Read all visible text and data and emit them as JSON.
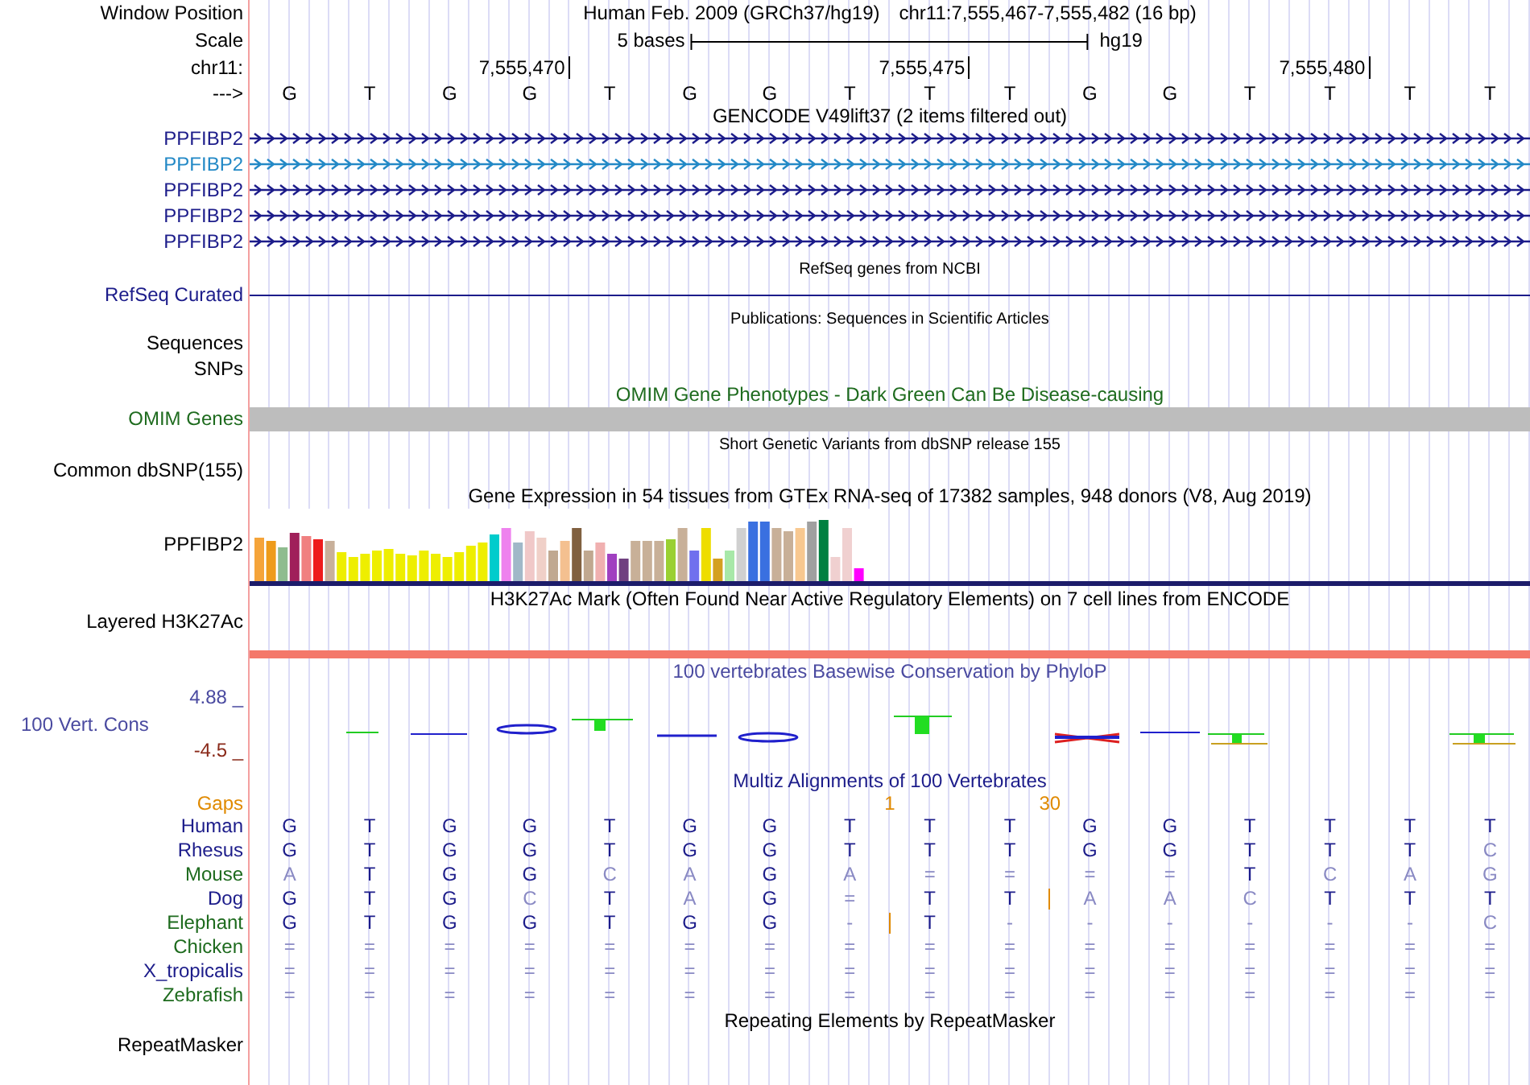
{
  "position_row": {
    "label": "Window Position",
    "assembly": "Human Feb. 2009 (GRCh37/hg19)",
    "range": "chr11:7,555,467-7,555,482 (16 bp)"
  },
  "scale_row": {
    "label": "Scale",
    "span": "5 bases",
    "assembly": "hg19"
  },
  "coordinate_row": {
    "label": "chr11:",
    "ticks": [
      "7,555,470",
      "7,555,475",
      "7,555,480"
    ]
  },
  "sequence_row": {
    "label": "--->",
    "bases": [
      "G",
      "T",
      "G",
      "G",
      "T",
      "G",
      "G",
      "T",
      "T",
      "T",
      "G",
      "G",
      "T",
      "T",
      "T",
      "T"
    ]
  },
  "tracks": [
    {
      "kind": "genes",
      "title": "GENCODE V49lift37 (2 items filtered out)",
      "items": [
        {
          "label": "PPFIBP2",
          "color": "#1c1c8a"
        },
        {
          "label": "PPFIBP2",
          "color": "#2389c6"
        },
        {
          "label": "PPFIBP2",
          "color": "#1c1c8a"
        },
        {
          "label": "PPFIBP2",
          "color": "#1c1c8a"
        },
        {
          "label": "PPFIBP2",
          "color": "#1c1c8a"
        }
      ]
    },
    {
      "kind": "curated",
      "title": "RefSeq genes from NCBI",
      "label": "RefSeq Curated"
    },
    {
      "kind": "publications",
      "title": "Publications: Sequences in Scientific Articles",
      "labels": [
        "Sequences",
        "SNPs"
      ]
    },
    {
      "kind": "omim",
      "title": "OMIM Gene Phenotypes - Dark Green Can Be Disease-causing",
      "label": "OMIM Genes"
    },
    {
      "kind": "snp",
      "title": "Short Genetic Variants from dbSNP release 155",
      "label": "Common dbSNP(155)"
    },
    {
      "kind": "expression",
      "title": "Gene Expression in 54 tissues from GTEx RNA-seq of 17382 samples, 948 donors (V8, Aug 2019)",
      "label": "PPFIBP2"
    },
    {
      "kind": "layered",
      "title": "H3K27Ac Mark (Often Found Near Active Regulatory Elements) on 7 cell lines from ENCODE",
      "label": "Layered H3K27Ac"
    },
    {
      "kind": "conservation",
      "title": "100 vertebrates Basewise Conservation by PhyloP",
      "label": "100 Vert. Cons",
      "max": "4.88 _",
      "min": "-4.5 _"
    },
    {
      "kind": "alignment",
      "title": "Multiz Alignments of 100 Vertebrates",
      "gaps_label": "Gaps",
      "gaps": [
        "1",
        "30"
      ],
      "species": [
        {
          "name": "Human",
          "color": "#1c1c8a",
          "bases": [
            {
              "base": "G",
              "match": true
            },
            {
              "base": "T",
              "match": true
            },
            {
              "base": "G",
              "match": true
            },
            {
              "base": "G",
              "match": true
            },
            {
              "base": "T",
              "match": true
            },
            {
              "base": "G",
              "match": true
            },
            {
              "base": "G",
              "match": true
            },
            {
              "base": "T",
              "match": true
            },
            {
              "base": "T",
              "match": true
            },
            {
              "base": "T",
              "match": true
            },
            {
              "base": "G",
              "match": true
            },
            {
              "base": "G",
              "match": true
            },
            {
              "base": "T",
              "match": true
            },
            {
              "base": "T",
              "match": true
            },
            {
              "base": "T",
              "match": true
            },
            {
              "base": "T",
              "match": true
            }
          ]
        },
        {
          "name": "Rhesus",
          "color": "#1c1c8a",
          "bases": [
            {
              "base": "G",
              "match": true
            },
            {
              "base": "T",
              "match": true
            },
            {
              "base": "G",
              "match": true
            },
            {
              "base": "G",
              "match": true
            },
            {
              "base": "T",
              "match": true
            },
            {
              "base": "G",
              "match": true
            },
            {
              "base": "G",
              "match": true
            },
            {
              "base": "T",
              "match": true
            },
            {
              "base": "T",
              "match": true
            },
            {
              "base": "T",
              "match": true
            },
            {
              "base": "G",
              "match": true
            },
            {
              "base": "G",
              "match": true
            },
            {
              "base": "T",
              "match": true
            },
            {
              "base": "T",
              "match": true
            },
            {
              "base": "T",
              "match": true
            },
            {
              "base": "C",
              "match": false
            }
          ]
        },
        {
          "name": "Mouse",
          "color": "#1e6b1e",
          "bases": [
            {
              "base": "A",
              "match": false
            },
            {
              "base": "T",
              "match": true
            },
            {
              "base": "G",
              "match": true
            },
            {
              "base": "G",
              "match": true
            },
            {
              "base": "C",
              "match": false
            },
            {
              "base": "A",
              "match": false
            },
            {
              "base": "G",
              "match": true
            },
            {
              "base": "A",
              "match": false
            },
            {
              "base": "=",
              "match": false
            },
            {
              "base": "=",
              "match": false
            },
            {
              "base": "=",
              "match": false
            },
            {
              "base": "=",
              "match": false
            },
            {
              "base": "T",
              "match": true
            },
            {
              "base": "C",
              "match": false
            },
            {
              "base": "A",
              "match": false
            },
            {
              "base": "G",
              "match": false
            }
          ]
        },
        {
          "name": "Dog",
          "color": "#1c1c8a",
          "bases": [
            {
              "base": "G",
              "match": true,
              "insert_after": false
            },
            {
              "base": "T",
              "match": true,
              "insert_after": false
            },
            {
              "base": "G",
              "match": true,
              "insert_after": false
            },
            {
              "base": "C",
              "match": false,
              "insert_after": false
            },
            {
              "base": "T",
              "match": true,
              "insert_after": false
            },
            {
              "base": "A",
              "match": false,
              "insert_after": false
            },
            {
              "base": "G",
              "match": true,
              "insert_after": false
            },
            {
              "base": "=",
              "match": false,
              "insert_after": false
            },
            {
              "base": "T",
              "match": true,
              "insert_after": false
            },
            {
              "base": "T",
              "match": true,
              "insert_after": true
            },
            {
              "base": "A",
              "match": false,
              "insert_after": false
            },
            {
              "base": "A",
              "match": false,
              "insert_after": false
            },
            {
              "base": "C",
              "match": false,
              "insert_after": false
            },
            {
              "base": "T",
              "match": true,
              "insert_after": false
            },
            {
              "base": "T",
              "match": true,
              "insert_after": false
            },
            {
              "base": "T",
              "match": true,
              "insert_after": false
            }
          ]
        },
        {
          "name": "Elephant",
          "color": "#1e6b1e",
          "bases": [
            {
              "base": "G",
              "match": true,
              "insert_after": false
            },
            {
              "base": "T",
              "match": true,
              "insert_after": false
            },
            {
              "base": "G",
              "match": true,
              "insert_after": false
            },
            {
              "base": "G",
              "match": true,
              "insert_after": false
            },
            {
              "base": "T",
              "match": true,
              "insert_after": false
            },
            {
              "base": "G",
              "match": true,
              "insert_after": false
            },
            {
              "base": "G",
              "match": true,
              "insert_after": false
            },
            {
              "base": "-",
              "match": false,
              "insert_after": true
            },
            {
              "base": "T",
              "match": true,
              "insert_after": false
            },
            {
              "base": "-",
              "match": false,
              "insert_after": false
            },
            {
              "base": "-",
              "match": false,
              "insert_after": false
            },
            {
              "base": "-",
              "match": false,
              "insert_after": false
            },
            {
              "base": "-",
              "match": false,
              "insert_after": false
            },
            {
              "base": "-",
              "match": false,
              "insert_after": false
            },
            {
              "base": "-",
              "match": false,
              "insert_after": false
            },
            {
              "base": "C",
              "match": false,
              "insert_after": false
            }
          ]
        },
        {
          "name": "Chicken",
          "color": "#1e6b1e",
          "bases": [
            {
              "base": "=",
              "match": false
            },
            {
              "base": "=",
              "match": false
            },
            {
              "base": "=",
              "match": false
            },
            {
              "base": "=",
              "match": false
            },
            {
              "base": "=",
              "match": false
            },
            {
              "base": "=",
              "match": false
            },
            {
              "base": "=",
              "match": false
            },
            {
              "base": "=",
              "match": false
            },
            {
              "base": "=",
              "match": false
            },
            {
              "base": "=",
              "match": false
            },
            {
              "base": "=",
              "match": false
            },
            {
              "base": "=",
              "match": false
            },
            {
              "base": "=",
              "match": false
            },
            {
              "base": "=",
              "match": false
            },
            {
              "base": "=",
              "match": false
            },
            {
              "base": "=",
              "match": false
            }
          ]
        },
        {
          "name": "X_tropicalis",
          "color": "#1c1c8a",
          "bases": [
            {
              "base": "=",
              "match": false
            },
            {
              "base": "=",
              "match": false
            },
            {
              "base": "=",
              "match": false
            },
            {
              "base": "=",
              "match": false
            },
            {
              "base": "=",
              "match": false
            },
            {
              "base": "=",
              "match": false
            },
            {
              "base": "=",
              "match": false
            },
            {
              "base": "=",
              "match": false
            },
            {
              "base": "=",
              "match": false
            },
            {
              "base": "=",
              "match": false
            },
            {
              "base": "=",
              "match": false
            },
            {
              "base": "=",
              "match": false
            },
            {
              "base": "=",
              "match": false
            },
            {
              "base": "=",
              "match": false
            },
            {
              "base": "=",
              "match": false
            },
            {
              "base": "=",
              "match": false
            }
          ]
        },
        {
          "name": "Zebrafish",
          "color": "#1e6b1e",
          "bases": [
            {
              "base": "=",
              "match": false
            },
            {
              "base": "=",
              "match": false
            },
            {
              "base": "=",
              "match": false
            },
            {
              "base": "=",
              "match": false
            },
            {
              "base": "=",
              "match": false
            },
            {
              "base": "=",
              "match": false
            },
            {
              "base": "=",
              "match": false
            },
            {
              "base": "=",
              "match": false
            },
            {
              "base": "=",
              "match": false
            },
            {
              "base": "=",
              "match": false
            },
            {
              "base": "=",
              "match": false
            },
            {
              "base": "=",
              "match": false
            },
            {
              "base": "=",
              "match": false
            },
            {
              "base": "=",
              "match": false
            },
            {
              "base": "=",
              "match": false
            },
            {
              "base": "=",
              "match": false
            }
          ]
        }
      ]
    },
    {
      "kind": "repeats",
      "title": "Repeating Elements by RepeatMasker",
      "label": "RepeatMasker"
    }
  ]
}
